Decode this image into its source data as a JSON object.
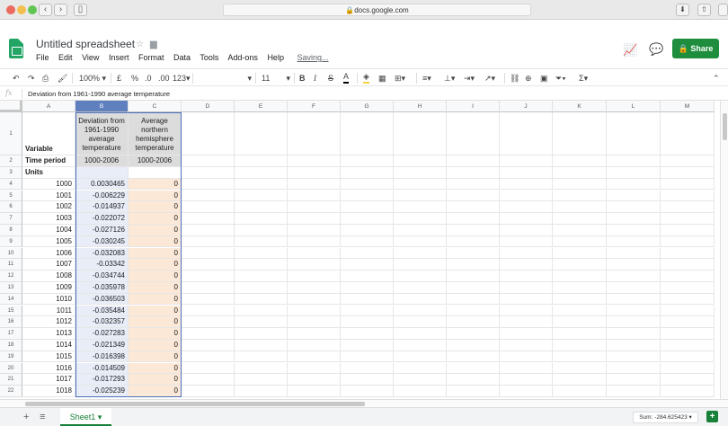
{
  "browser": {
    "url": "docs.google.com",
    "back_icon": "chevron-left-icon",
    "forward_icon": "chevron-right-icon"
  },
  "doc": {
    "title": "Untitled spreadsheet",
    "saving": "Saving...",
    "share_label": "Share"
  },
  "menu": [
    "File",
    "Edit",
    "View",
    "Insert",
    "Format",
    "Data",
    "Tools",
    "Add-ons",
    "Help"
  ],
  "toolbar": {
    "zoom": "100%",
    "currency": "£",
    "percent": "%",
    "dec_less": ".0",
    "dec_more": ".00",
    "format": "123",
    "font_size": "11"
  },
  "formula_bar": {
    "fx": "fx",
    "content": "Deviation from 1961-1990 average temperature"
  },
  "columns": [
    "A",
    "B",
    "C",
    "D",
    "E",
    "F",
    "G",
    "H",
    "I",
    "J",
    "K",
    "L",
    "M"
  ],
  "rows": {
    "headers": [
      "Variable",
      "Deviation from 1961-1990 average temperature",
      "Average northern hemisphere temperature"
    ],
    "time_period": [
      "Time period",
      "1000-2006",
      "1000-2006"
    ],
    "units": [
      "Units",
      "",
      ""
    ],
    "data": [
      [
        "1000",
        "0.0030465",
        "0"
      ],
      [
        "1001",
        "-0.006229",
        "0"
      ],
      [
        "1002",
        "-0.014937",
        "0"
      ],
      [
        "1003",
        "-0.022072",
        "0"
      ],
      [
        "1004",
        "-0.027126",
        "0"
      ],
      [
        "1005",
        "-0.030245",
        "0"
      ],
      [
        "1006",
        "-0.032083",
        "0"
      ],
      [
        "1007",
        "-0.03342",
        "0"
      ],
      [
        "1008",
        "-0.034744",
        "0"
      ],
      [
        "1009",
        "-0.035978",
        "0"
      ],
      [
        "1010",
        "-0.036503",
        "0"
      ],
      [
        "1011",
        "-0.035484",
        "0"
      ],
      [
        "1012",
        "-0.032357",
        "0"
      ],
      [
        "1013",
        "-0.027283",
        "0"
      ],
      [
        "1014",
        "-0.021349",
        "0"
      ],
      [
        "1015",
        "-0.016398",
        "0"
      ],
      [
        "1016",
        "-0.014509",
        "0"
      ],
      [
        "1017",
        "-0.017293",
        "0"
      ],
      [
        "1018",
        "-0.025239",
        "0"
      ]
    ]
  },
  "sheet": {
    "tab": "Sheet1",
    "sum": "Sum: -284.625423"
  },
  "colors": {
    "accent": "#188038",
    "selection": "#5f7fbf"
  }
}
